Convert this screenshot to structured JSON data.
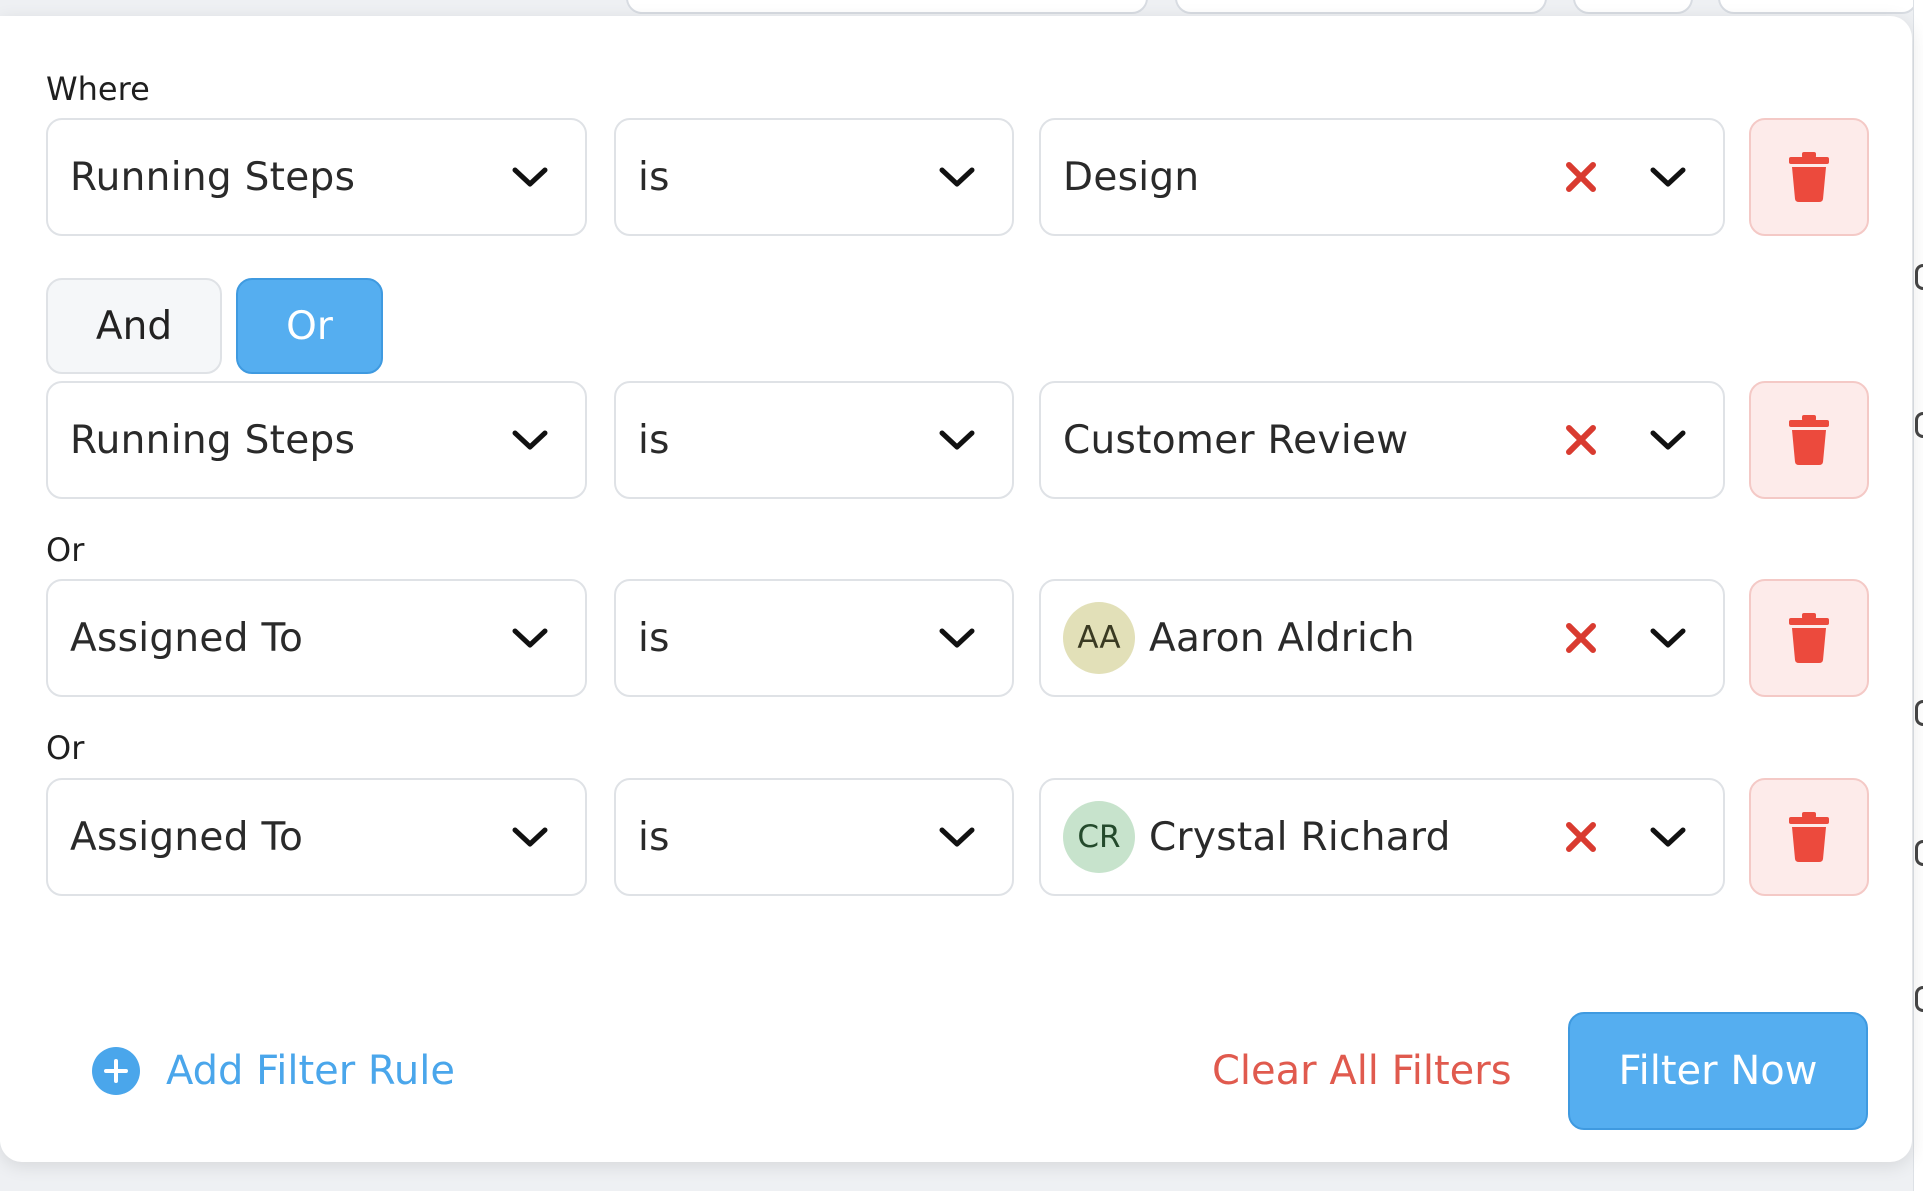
{
  "where_label": "Where",
  "rules": [
    {
      "field": "Running Steps",
      "operator": "is",
      "value": "Design",
      "avatar": null
    },
    {
      "field": "Running Steps",
      "operator": "is",
      "value": "Customer Review",
      "avatar": null
    },
    {
      "field": "Assigned To",
      "operator": "is",
      "value": "Aaron Aldrich",
      "avatar": {
        "initials": "AA",
        "bg": "#e2e0b8",
        "fg": "#3a3a22"
      }
    },
    {
      "field": "Assigned To",
      "operator": "is",
      "value": "Crystal Richard",
      "avatar": {
        "initials": "CR",
        "bg": "#c7e3cc",
        "fg": "#244a2c"
      }
    }
  ],
  "conjunction_toggle": {
    "and_label": "And",
    "or_label": "Or",
    "selected": "Or"
  },
  "conjunction_labels": [
    "Or",
    "Or"
  ],
  "footer": {
    "add_rule_label": "Add Filter Rule",
    "clear_all_label": "Clear All Filters",
    "filter_now_label": "Filter Now"
  },
  "icons": {
    "chevron": "chevron-down-icon",
    "clear": "close-icon",
    "delete": "trash-icon",
    "add": "plus-circle-icon"
  },
  "colors": {
    "accent": "#55aef0",
    "danger": "#d93b30",
    "clear_all_text": "#e05a4e"
  }
}
